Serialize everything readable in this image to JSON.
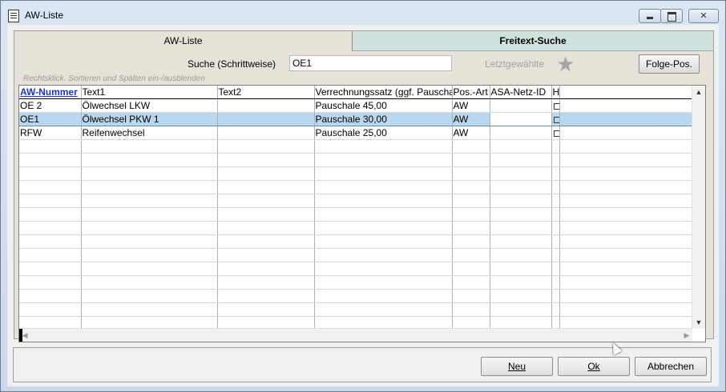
{
  "window": {
    "title": "AW-Liste"
  },
  "tabs": [
    {
      "label": "AW-Liste",
      "active": true
    },
    {
      "label": "Freitext-Suche",
      "active": false
    }
  ],
  "search": {
    "label": "Suche (Schrittweise)",
    "value": "OE1"
  },
  "hint": "Rechtsklick. Sortieren und Spalten ein-/ausblenden",
  "recent_label": "Letztgewählte",
  "folge_button": "Folge-Pos.",
  "table": {
    "columns": [
      "AW-Nummer",
      "Text1",
      "Text2",
      "Verrechnungssatz (ggf. Pauschale)",
      "Pos.-Art",
      "ASA-Netz-ID",
      "H"
    ],
    "sorted_column": "AW-Nummer",
    "rows": [
      {
        "nummer": "OE 2",
        "text1": "Ölwechsel LKW",
        "text2": "",
        "satz": "Pauschale 45,00",
        "posart": "AW",
        "asa": "",
        "selected": false
      },
      {
        "nummer": "OE1",
        "text1": "Ölwechsel PKW 1",
        "text2": "",
        "satz": "Pauschale 30,00",
        "posart": "AW",
        "asa": "",
        "selected": true
      },
      {
        "nummer": "RFW",
        "text1": "Reifenwechsel",
        "text2": "",
        "satz": "Pauschale 25,00",
        "posart": "AW",
        "asa": "",
        "selected": false
      }
    ]
  },
  "buttons": {
    "neu": "Neu",
    "ok": "Ok",
    "abbrechen": "Abbrechen"
  },
  "colors": {
    "selection": "#b9d7ee",
    "sorted_header": "#1a37c6",
    "freitext_tab": "#cfe2de"
  }
}
